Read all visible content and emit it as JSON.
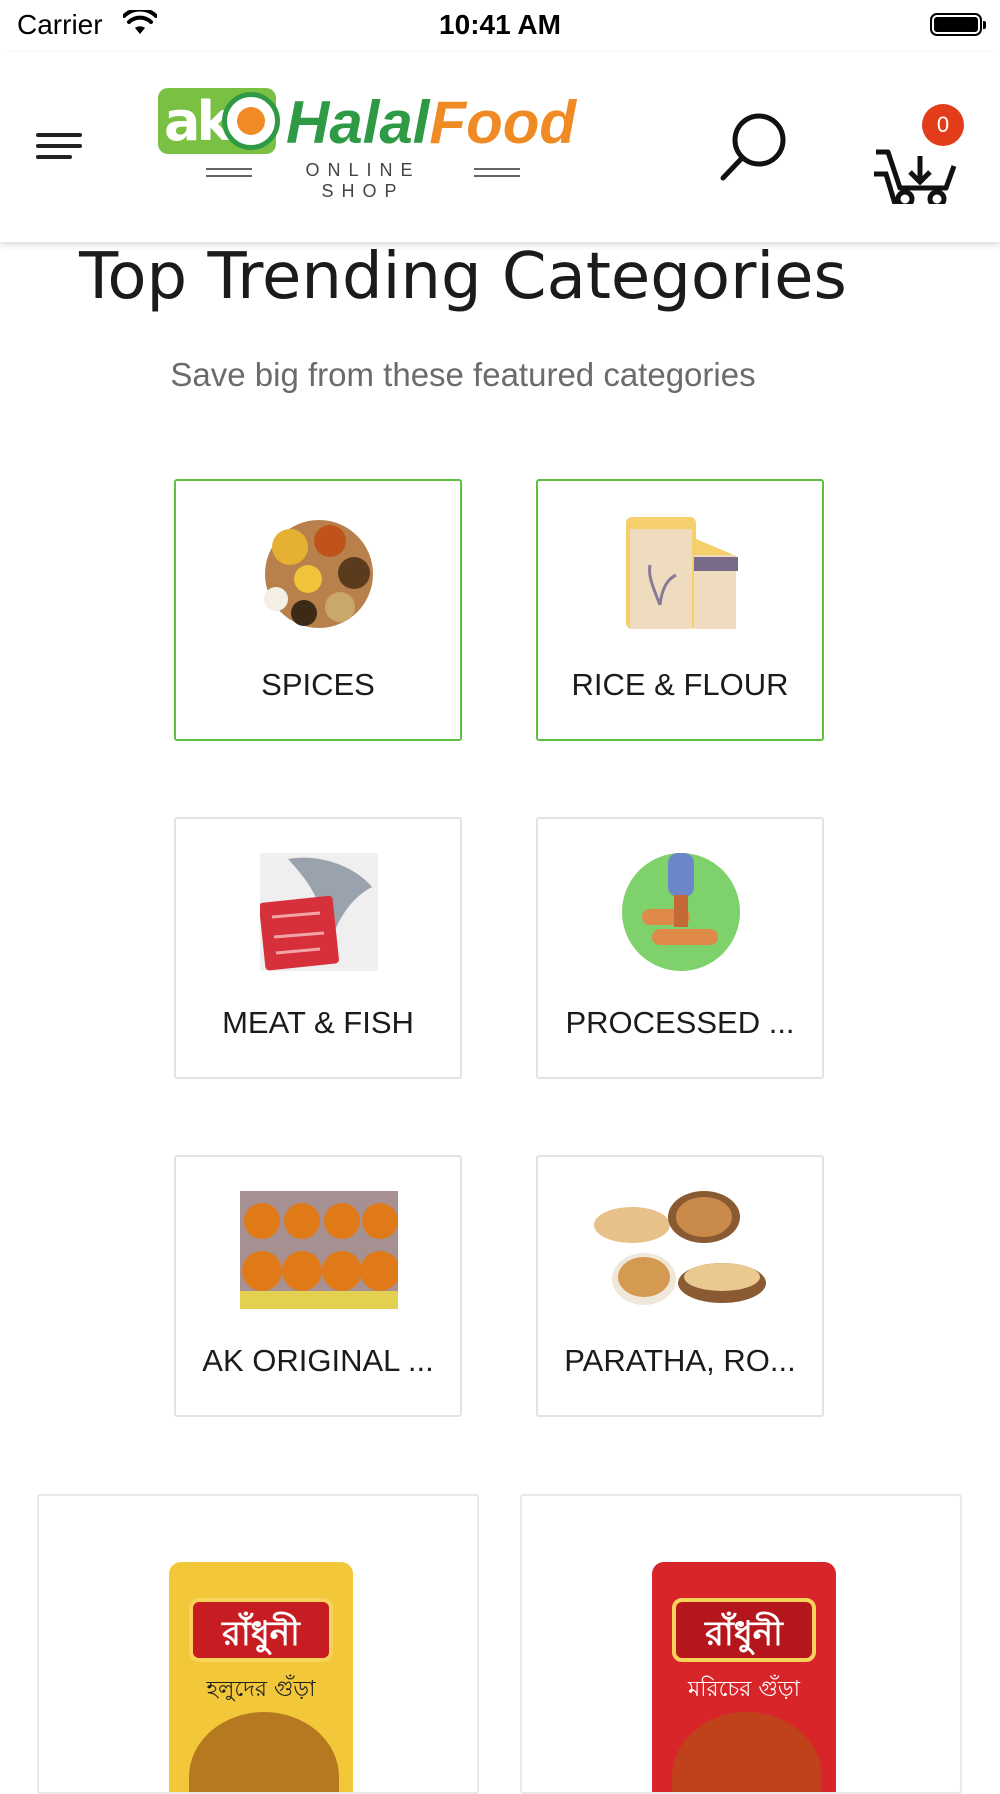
{
  "status_bar": {
    "carrier": "Carrier",
    "time": "10:41 AM"
  },
  "header": {
    "menu_icon": "hamburger-menu-icon",
    "logo": {
      "ak_text": "ak",
      "word_part1": "Halal",
      "word_part2": "Food",
      "tagline": "ONLINE SHOP"
    },
    "search_icon": "search-icon",
    "cart_icon": "cart-icon",
    "cart_count": "0"
  },
  "section": {
    "title": "Top Trending Categories",
    "subtitle": "Save big from these featured categories"
  },
  "categories": [
    {
      "label": "SPICES",
      "icon": "spices-image",
      "active": true
    },
    {
      "label": "RICE & FLOUR",
      "icon": "rice-flour-image",
      "active": true
    },
    {
      "label": "MEAT & FISH",
      "icon": "meat-fish-image",
      "active": false
    },
    {
      "label": "PROCESSED ...",
      "icon": "processed-food-image",
      "active": false
    },
    {
      "label": "AK ORIGINAL ...",
      "icon": "ak-original-image",
      "active": false
    },
    {
      "label": "PARATHA, RO...",
      "icon": "paratha-image",
      "active": false
    }
  ],
  "products": [
    {
      "brand": "রাঁধুনী",
      "name": "হলুদের গুঁড়া",
      "color": "#f2c73a",
      "powder": "#b7791f"
    },
    {
      "brand": "রাঁধুনী",
      "name": "মরিচের গুঁড়া",
      "color": "#d8252a",
      "powder": "#c0421b"
    }
  ],
  "colors": {
    "accent_green": "#5cc042",
    "logo_green": "#2e9a46",
    "logo_orange": "#f08a24",
    "badge_red": "#e23c1a"
  }
}
